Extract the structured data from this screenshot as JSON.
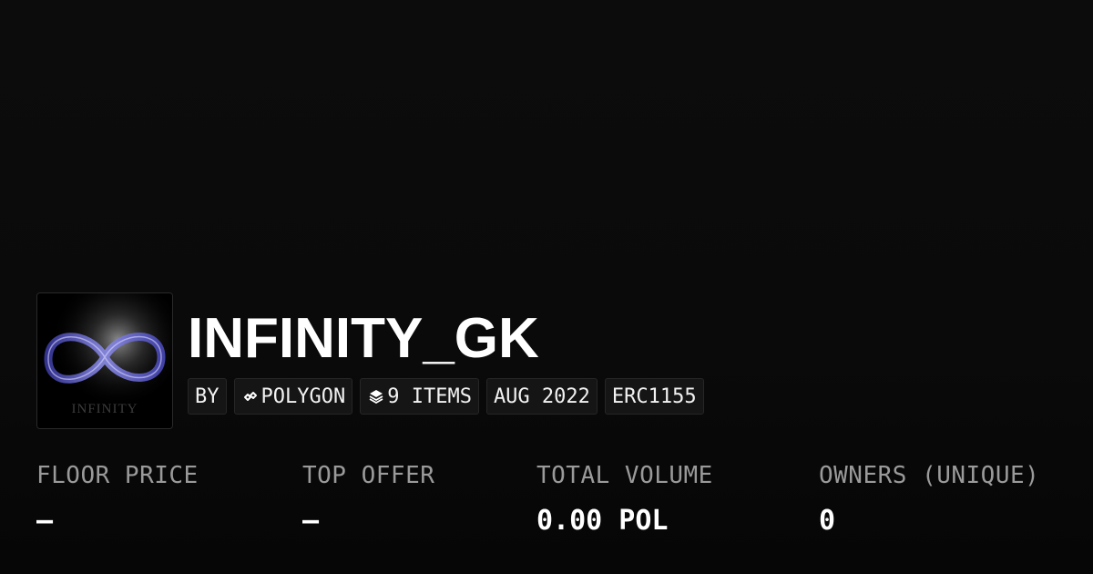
{
  "collection": {
    "title": "INFINITY_GK",
    "thumbnail_caption": "INFINITY"
  },
  "badges": {
    "by_label": "BY",
    "chain": "POLYGON",
    "chain_icon": "polygon-icon",
    "items": "9 ITEMS",
    "items_icon": "layers-icon",
    "created": "AUG 2022",
    "standard": "ERC1155"
  },
  "stats": [
    {
      "label": "FLOOR PRICE",
      "value": "–"
    },
    {
      "label": "TOP OFFER",
      "value": "–"
    },
    {
      "label": "TOTAL VOLUME",
      "value": "0.00 POL"
    },
    {
      "label": "OWNERS (UNIQUE)",
      "value": "0"
    }
  ],
  "colors": {
    "background": "#0b0b0b",
    "badge_background": "#151515",
    "label_gray": "#9a9a9a",
    "infinity_accent": "#6b6bd6"
  }
}
